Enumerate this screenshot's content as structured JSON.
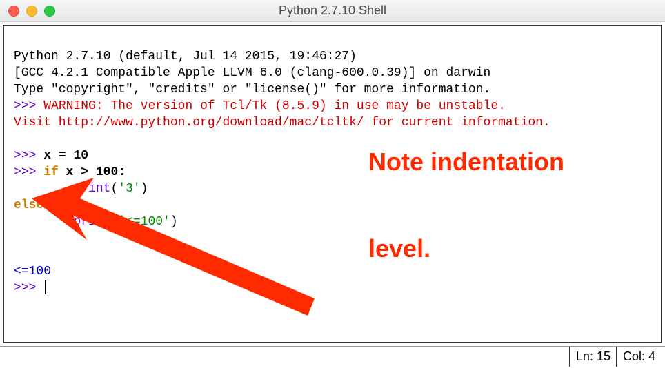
{
  "window": {
    "title": "Python 2.7.10 Shell"
  },
  "shell": {
    "banner1": "Python 2.7.10 (default, Jul 14 2015, 19:46:27)",
    "banner2": "[GCC 4.2.1 Compatible Apple LLVM 6.0 (clang-600.0.39)] on darwin",
    "banner3": "Type \"copyright\", \"credits\" or \"license()\" for more information.",
    "warnPrompt": ">>> ",
    "warnLabel": "WARNING",
    "warnColon": ": ",
    "warnText": "The version of Tcl/Tk (8.5.9) in use may be unstable.",
    "visitText": "Visit http://www.python.org/download/mac/tcltk/ for current information.",
    "promptA": ">>> ",
    "assignA": "x ",
    "assignEq": "= ",
    "assignVal": "10",
    "promptB": ">>> ",
    "ifKw": "if",
    "ifCond": " x > 100:",
    "indent1": "        ",
    "printKw1": "print",
    "printArg1Open": "(",
    "printArg1Str": "'3'",
    "printArg1Close": ")",
    "elseKw": "else",
    "elseColon": ":",
    "indent2": "        ",
    "printKw2": "print",
    "printArg2Open": "(",
    "printArg2Str": "'<=100'",
    "printArg2Close": ")",
    "output": "<=100",
    "promptEnd": ">>> "
  },
  "annotation": {
    "line1": "Note indentation",
    "line2": "level."
  },
  "status": {
    "line": "Ln: 15",
    "col": "Col: 4"
  }
}
